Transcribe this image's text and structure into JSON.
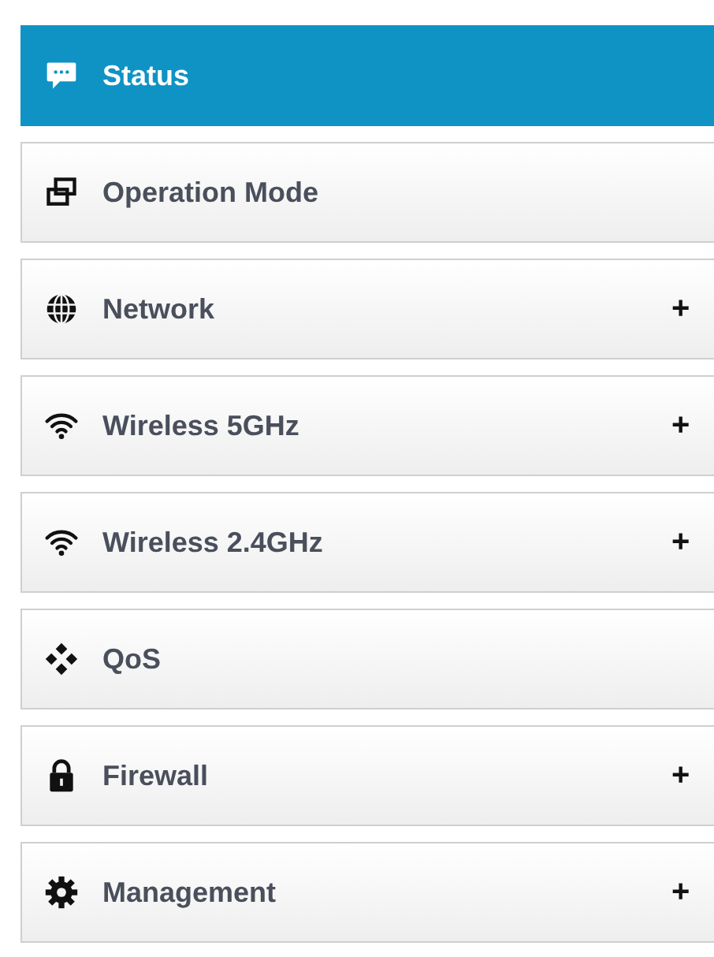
{
  "menu": [
    {
      "kind": "chat",
      "label": "Status",
      "selected": true
    },
    {
      "kind": "windows",
      "label": "Operation Mode",
      "selected": false
    },
    {
      "kind": "globe",
      "label": "Network",
      "selected": false,
      "expander": "+"
    },
    {
      "kind": "wifi",
      "label": "Wireless 5GHz",
      "selected": false,
      "expander": "+"
    },
    {
      "kind": "wifi",
      "label": "Wireless 2.4GHz",
      "selected": false,
      "expander": "+"
    },
    {
      "kind": "diamonds",
      "label": "QoS",
      "selected": false
    },
    {
      "kind": "lock",
      "label": "Firewall",
      "selected": false,
      "expander": "+"
    },
    {
      "kind": "gear",
      "label": "Management",
      "selected": false,
      "expander": "+"
    }
  ]
}
